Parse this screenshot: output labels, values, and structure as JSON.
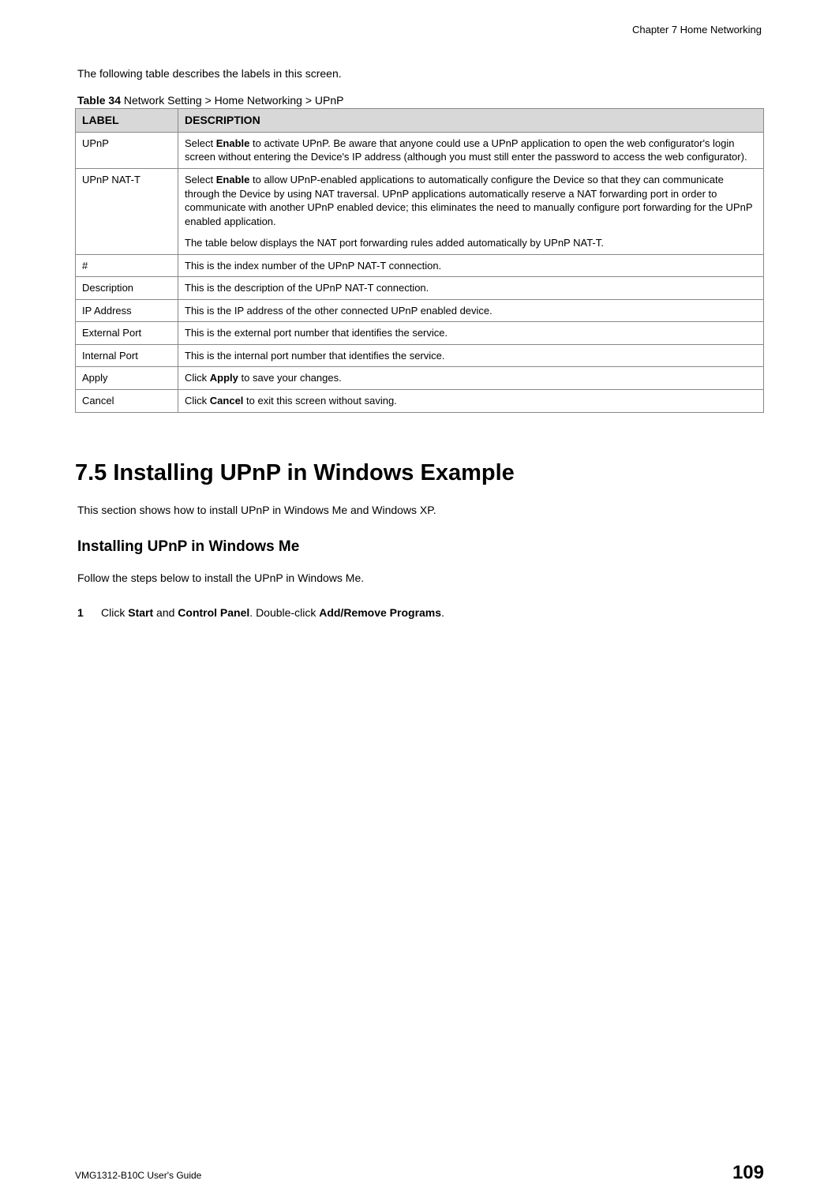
{
  "header": {
    "chapter": "Chapter 7 Home Networking"
  },
  "introText": "The following table describes the labels in this screen.",
  "tableCaption": {
    "label": "Table 34",
    "text": "   Network Setting > Home Networking > UPnP"
  },
  "tableHeaders": {
    "col1": "LABEL",
    "col2": "DESCRIPTION"
  },
  "tableRows": [
    {
      "label": "UPnP",
      "desc": [
        {
          "type": "p",
          "segments": [
            {
              "text": "Select "
            },
            {
              "text": "Enable",
              "bold": true
            },
            {
              "text": " to activate UPnP. Be aware that anyone could use a UPnP application to open the web configurator's login screen without entering the Device's IP address (although you must still enter the password to access the web configurator)."
            }
          ]
        }
      ]
    },
    {
      "label": "UPnP NAT-T",
      "desc": [
        {
          "type": "p",
          "segments": [
            {
              "text": "Select "
            },
            {
              "text": "Enable",
              "bold": true
            },
            {
              "text": " to allow UPnP-enabled applications to automatically configure the Device so that they can communicate through the Device by using NAT traversal. UPnP applications automatically reserve a NAT forwarding port in order to communicate with another UPnP enabled device; this eliminates the need to manually configure port forwarding for the UPnP enabled application."
            }
          ]
        },
        {
          "type": "p",
          "segments": [
            {
              "text": "The table below displays the NAT port forwarding rules added automatically by UPnP NAT-T."
            }
          ]
        }
      ]
    },
    {
      "label": "#",
      "desc": [
        {
          "type": "p",
          "segments": [
            {
              "text": "This is the index number of the UPnP NAT-T connection."
            }
          ]
        }
      ]
    },
    {
      "label": "Description",
      "desc": [
        {
          "type": "p",
          "segments": [
            {
              "text": "This is the description of the UPnP NAT-T connection."
            }
          ]
        }
      ]
    },
    {
      "label": "IP Address",
      "desc": [
        {
          "type": "p",
          "segments": [
            {
              "text": "This is the IP address of the other connected UPnP enabled device."
            }
          ]
        }
      ]
    },
    {
      "label": "External Port",
      "desc": [
        {
          "type": "p",
          "segments": [
            {
              "text": "This is the external port number that identifies the service."
            }
          ]
        }
      ]
    },
    {
      "label": "Internal Port",
      "desc": [
        {
          "type": "p",
          "segments": [
            {
              "text": "This is the internal port number that identifies the service."
            }
          ]
        }
      ]
    },
    {
      "label": "Apply",
      "desc": [
        {
          "type": "p",
          "segments": [
            {
              "text": "Click "
            },
            {
              "text": "Apply",
              "bold": true
            },
            {
              "text": " to save your changes."
            }
          ]
        }
      ]
    },
    {
      "label": "Cancel",
      "desc": [
        {
          "type": "p",
          "segments": [
            {
              "text": "Click "
            },
            {
              "text": "Cancel",
              "bold": true
            },
            {
              "text": " to exit this screen without saving."
            }
          ]
        }
      ]
    }
  ],
  "section": {
    "heading": "7.5  Installing UPnP in Windows Example",
    "intro": "This section shows how to install UPnP in Windows Me and Windows XP.",
    "subsectionHeading": "Installing UPnP in Windows Me",
    "subsectionIntro": "Follow the steps below to install the UPnP in Windows Me.",
    "step1": {
      "num": "1",
      "segments": [
        {
          "text": "Click "
        },
        {
          "text": "Start",
          "bold": true
        },
        {
          "text": " and "
        },
        {
          "text": "Control Panel",
          "bold": true
        },
        {
          "text": ". Double-click "
        },
        {
          "text": "Add/Remove Programs",
          "bold": true
        },
        {
          "text": "."
        }
      ]
    }
  },
  "footer": {
    "left": "VMG1312-B10C User's Guide",
    "right": "109"
  }
}
